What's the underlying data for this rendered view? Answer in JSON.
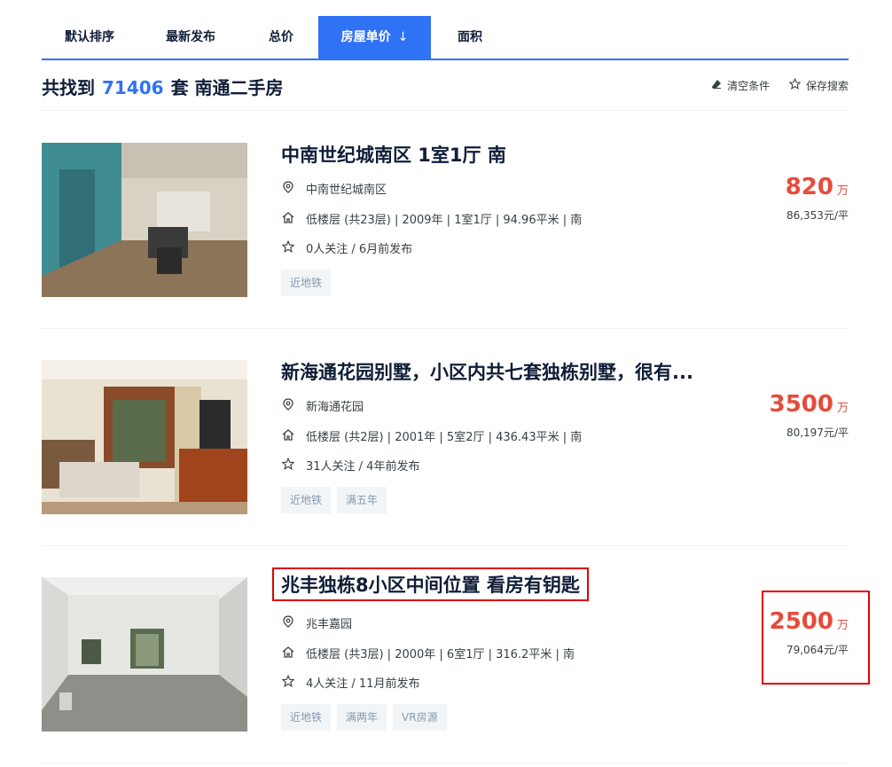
{
  "tabs": [
    {
      "label": "默认排序"
    },
    {
      "label": "最新发布"
    },
    {
      "label": "总价"
    },
    {
      "label": "房屋单价",
      "arrow": "↓"
    },
    {
      "label": "面积"
    }
  ],
  "summary": {
    "prefix": "共找到",
    "count": "71406",
    "suffix": "套 南通二手房"
  },
  "actions": {
    "clear_icon": "eraser-icon",
    "clear_label": "清空条件",
    "save_icon": "star-icon",
    "save_label": "保存搜索"
  },
  "listings": [
    {
      "title": "中南世纪城南区 1室1厅 南",
      "community": "中南世纪城南区",
      "house_info": "低楼层 (共23层) | 2009年 | 1室1厅 | 94.96平米 | 南",
      "follow_info": "0人关注 / 6月前发布",
      "tags": [
        "近地铁"
      ],
      "total_price": "820",
      "total_unit": "万",
      "unit_price": "86,353元/平"
    },
    {
      "title": "新海通花园别墅，小区内共七套独栋别墅，很有...",
      "community": "新海通花园",
      "house_info": "低楼层 (共2层) | 2001年 | 5室2厅 | 436.43平米 | 南",
      "follow_info": "31人关注 / 4年前发布",
      "tags": [
        "近地铁",
        "满五年"
      ],
      "total_price": "3500",
      "total_unit": "万",
      "unit_price": "80,197元/平"
    },
    {
      "title": "兆丰独栋8小区中间位置 看房有钥匙",
      "community": "兆丰嘉园",
      "house_info": "低楼层 (共3层) | 2000年 | 6室1厅 | 316.2平米 | 南",
      "follow_info": "4人关注 / 11月前发布",
      "tags": [
        "近地铁",
        "满两年",
        "VR房源"
      ],
      "total_price": "2500",
      "total_unit": "万",
      "unit_price": "79,064元/平"
    }
  ],
  "icons": {
    "location": "location-pin-icon",
    "house": "house-icon",
    "star": "star-icon"
  },
  "colors": {
    "accent": "#3072f6",
    "price": "#e64b3c",
    "highlight_box": "#e00000",
    "tag_bg": "#f2f5f7",
    "tag_text": "#849aae"
  }
}
